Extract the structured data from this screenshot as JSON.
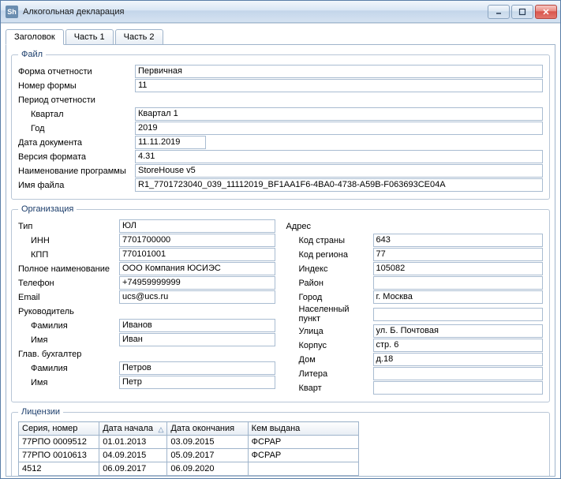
{
  "window": {
    "title": "Алкогольная декларация",
    "app_icon_text": "Sh"
  },
  "tabs": {
    "items": [
      {
        "label": "Заголовок"
      },
      {
        "label": "Часть 1"
      },
      {
        "label": "Часть 2"
      }
    ]
  },
  "file_group": {
    "legend": "Файл",
    "labels": {
      "report_form": "Форма отчетности",
      "form_number": "Номер формы",
      "period": "Период отчетности",
      "quarter": "Квартал",
      "year": "Год",
      "doc_date": "Дата документа",
      "format_ver": "Версия формата",
      "program_name": "Наименование программы",
      "file_name": "Имя файла"
    },
    "values": {
      "report_form": "Первичная",
      "form_number": "11",
      "quarter": "Квартал 1",
      "year": "2019",
      "doc_date": "11.11.2019",
      "format_ver": "4.31",
      "program_name": "StoreHouse v5",
      "file_name": "R1_7701723040_039_11112019_BF1AA1F6-4BA0-4738-A59B-F063693CE04A"
    }
  },
  "org_group": {
    "legend": "Организация",
    "labels": {
      "type": "Тип",
      "inn": "ИНН",
      "kpp": "КПП",
      "full_name": "Полное наименование",
      "phone": "Телефон",
      "email": "Email",
      "head": "Руководитель",
      "fam": "Фамилия",
      "name": "Имя",
      "accountant": "Глав. бухгалтер",
      "address": "Адрес",
      "country": "Код страны",
      "region": "Код региона",
      "index": "Индекс",
      "district": "Район",
      "city": "Город",
      "locality": "Населенный пункт",
      "street": "Улица",
      "korpus": "Корпус",
      "house": "Дом",
      "litera": "Литера",
      "kvart": "Кварт"
    },
    "values": {
      "type": "ЮЛ",
      "inn": "7701700000",
      "kpp": "770101001",
      "full_name": "ООО Компания ЮСИЭС",
      "phone": "+74959999999",
      "email": "ucs@ucs.ru",
      "head_fam": "Иванов",
      "head_name": "Иван",
      "acc_fam": "Петров",
      "acc_name": "Петр",
      "country": "643",
      "region": "77",
      "index": "105082",
      "district": "",
      "city": "г. Москва",
      "locality": "",
      "street": "ул. Б. Почтовая",
      "korpus": "стр. 6",
      "house": "д.18",
      "litera": "",
      "kvart": ""
    }
  },
  "lic_group": {
    "legend": "Лицензии",
    "headers": {
      "series": "Серия, номер",
      "start": "Дата начала",
      "end": "Дата окончания",
      "issuer": "Кем выдана",
      "sort_indicator": "△"
    },
    "rows": [
      {
        "series": "77РПО 0009512",
        "start": "01.01.2013",
        "end": "03.09.2015",
        "issuer": "ФСРАР"
      },
      {
        "series": "77РПО 0010613",
        "start": "04.09.2015",
        "end": "05.09.2017",
        "issuer": "ФСРАР"
      },
      {
        "series": "4512",
        "start": "06.09.2017",
        "end": "06.09.2020",
        "issuer": ""
      }
    ]
  }
}
